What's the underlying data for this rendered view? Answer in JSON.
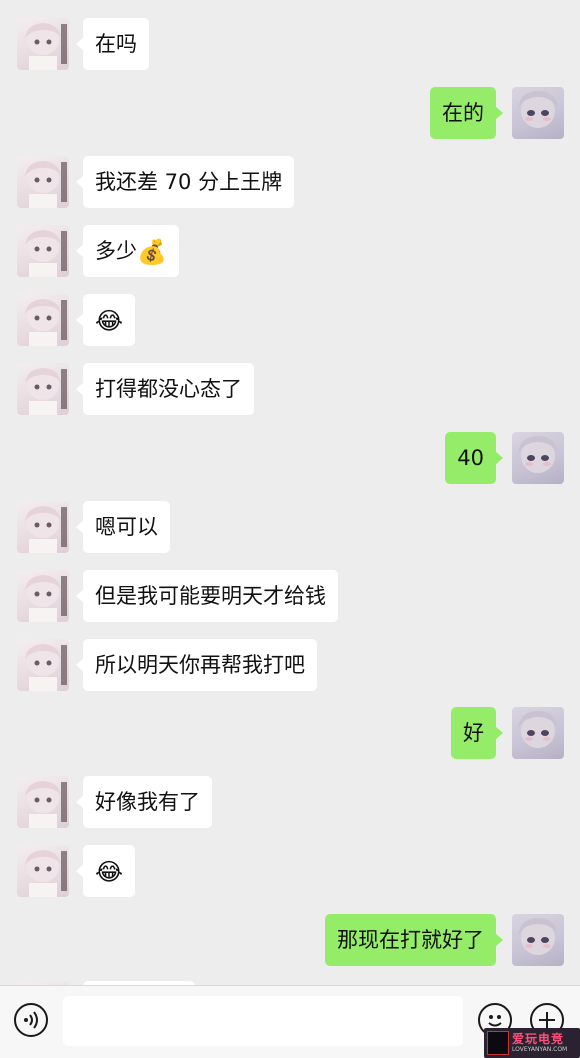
{
  "conversation": {
    "messages": [
      {
        "side": "left",
        "text": "在吗"
      },
      {
        "side": "right",
        "text": "在的"
      },
      {
        "side": "left",
        "text": "我还差 70 分上王牌"
      },
      {
        "side": "left",
        "text": "多少",
        "emoji": "💰"
      },
      {
        "side": "left",
        "emoji": "😂"
      },
      {
        "side": "left",
        "text": "打得都没心态了"
      },
      {
        "side": "right",
        "text": "40"
      },
      {
        "side": "left",
        "text": "嗯可以"
      },
      {
        "side": "left",
        "text": "但是我可能要明天才给钱"
      },
      {
        "side": "left",
        "text": "所以明天你再帮我打吧"
      },
      {
        "side": "right",
        "text": "好"
      },
      {
        "side": "left",
        "text": "好像我有了"
      },
      {
        "side": "left",
        "emoji": "😂"
      },
      {
        "side": "right",
        "text": "那现在打就好了"
      }
    ]
  },
  "input_bar": {
    "voice_icon": "voice-icon",
    "emoji_icon": "emoji-icon",
    "plus_icon": "plus-icon",
    "placeholder": ""
  },
  "watermark": {
    "main": "爱玩电竞",
    "sub": "LOVEYANYAN.COM"
  },
  "colors": {
    "background": "#ededed",
    "self_bubble": "#95ec69",
    "other_bubble": "#ffffff"
  }
}
